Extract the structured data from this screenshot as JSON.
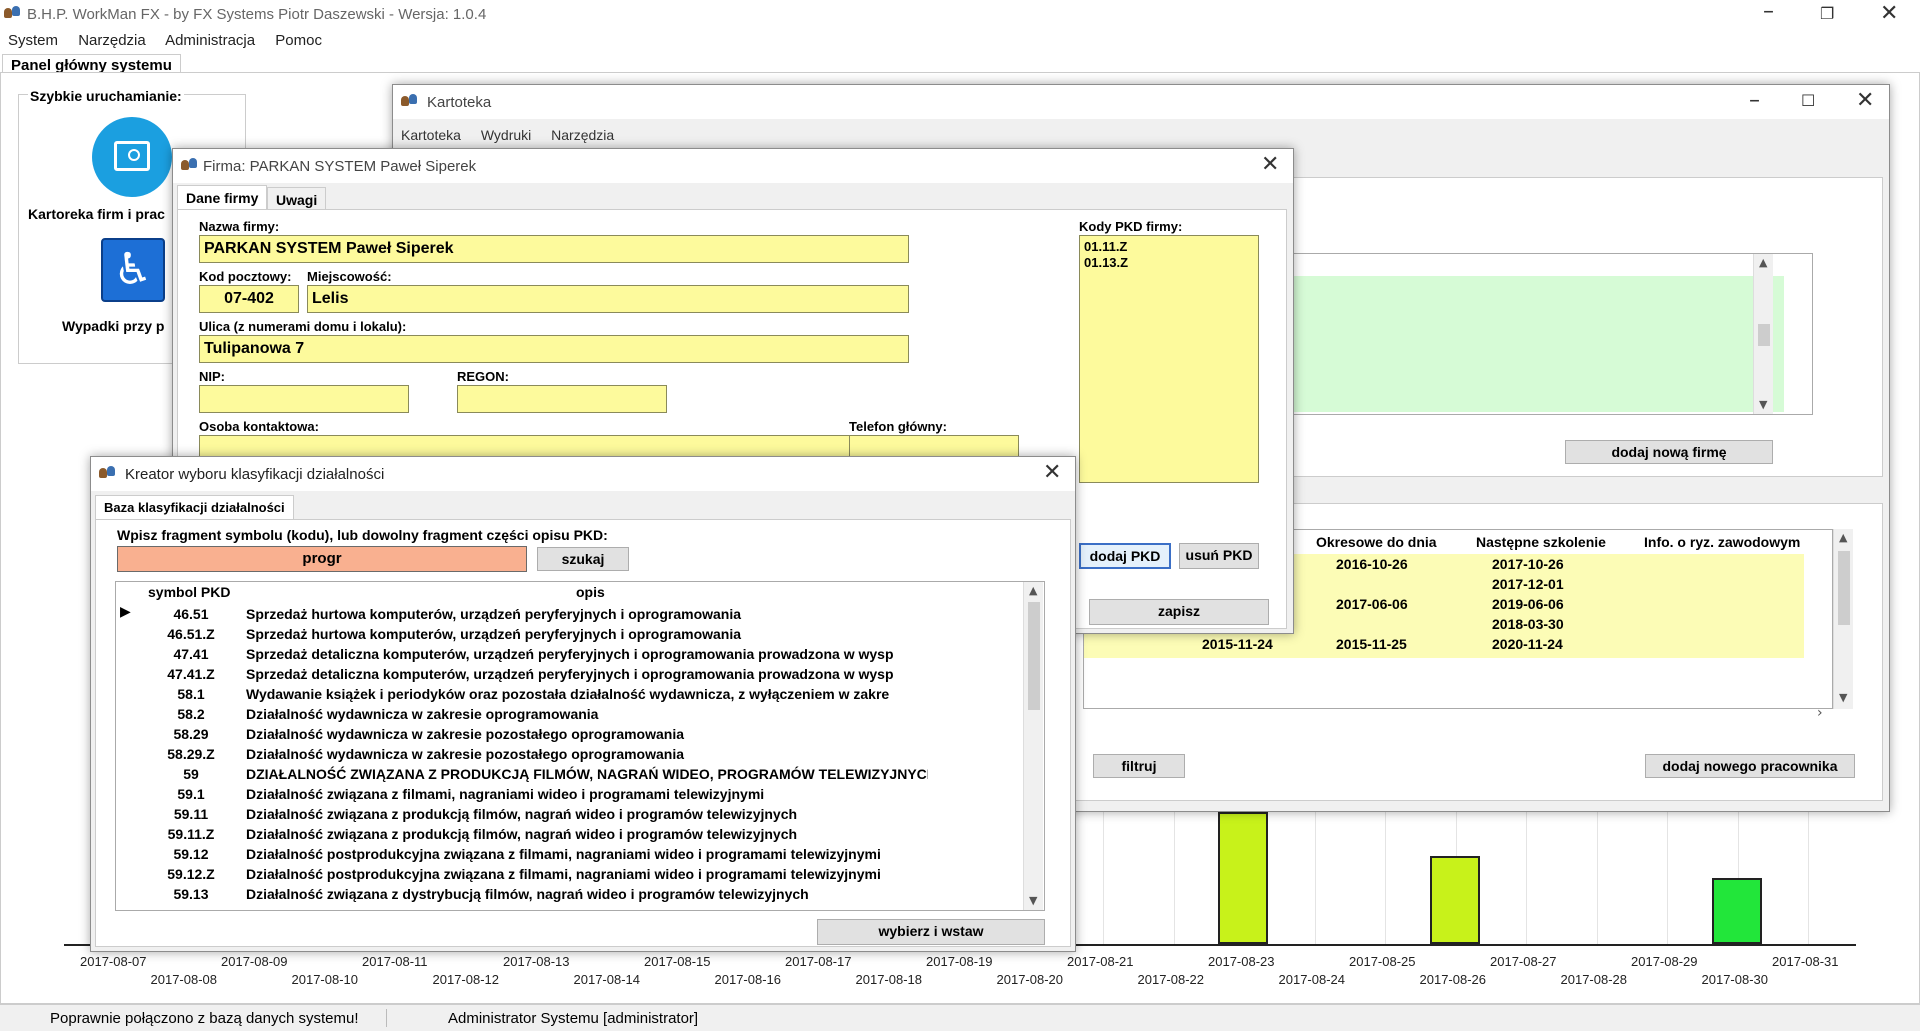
{
  "app": {
    "title": "B.H.P. WorkMan FX - by FX Systems Piotr Daszewski - Wersja: 1.0.4",
    "menu": [
      "System",
      "Narzędzia",
      "Administracja",
      "Pomoc"
    ],
    "main_tab": "Panel główny systemu"
  },
  "quick": {
    "title": "Szybkie uruchamianie:",
    "item1": "Kartoreka firm i prac",
    "item2": "Wypadki przy p"
  },
  "kartoteka": {
    "title": "Kartoteka",
    "menu": [
      "Kartoteka",
      "Wydruki",
      "Narzędzia"
    ],
    "add_company": "dodaj nową firmę",
    "headers": [
      "Okresowe do dnia",
      "Następne szkolenie",
      "Info. o ryz. zawodowym"
    ],
    "rows": [
      {
        "a": "",
        "b": "2016-10-26",
        "c": "2017-10-26"
      },
      {
        "a": "",
        "b": "",
        "c": "2017-12-01"
      },
      {
        "a": "",
        "b": "2017-06-06",
        "c": "2019-06-06"
      },
      {
        "a": "",
        "b": "",
        "c": "2018-03-30"
      },
      {
        "a": "2015-11-24",
        "b": "2015-11-25",
        "c": "2020-11-24"
      }
    ],
    "filter": "filtruj",
    "add_employee": "dodaj nowego pracownika"
  },
  "firma": {
    "title": "Firma: PARKAN SYSTEM Paweł Siperek",
    "tabs": [
      "Dane firmy",
      "Uwagi"
    ],
    "name_label": "Nazwa firmy:",
    "name": "PARKAN SYSTEM Paweł Siperek",
    "zip_label": "Kod pocztowy:",
    "zip": "07-402",
    "city_label": "Miejscowość:",
    "city": "Lelis",
    "street_label": "Ulica (z numerami domu i lokalu):",
    "street": "Tulipanowa 7",
    "nip_label": "NIP:",
    "regon_label": "REGON:",
    "contact_label": "Osoba kontaktowa:",
    "phone_label": "Telefon główny:",
    "pkd_label": "Kody PKD firmy:",
    "pkd_codes": [
      "01.11.Z",
      "01.13.Z"
    ],
    "add_pkd": "dodaj PKD",
    "remove_pkd": "usuń PKD",
    "save": "zapisz"
  },
  "kreator": {
    "title": "Kreator wyboru klasyfikacji działalności",
    "tab": "Baza klasyfikacji działalności",
    "prompt": "Wpisz fragment symbolu (kodu), lub dowolny fragment części opisu PKD:",
    "search_value": "progr",
    "search_button": "szukaj",
    "col_symbol": "symbol PKD",
    "col_desc": "opis",
    "rows": [
      {
        "s": "46.51",
        "d": "Sprzedaż hurtowa komputerów, urządzeń peryferyjnych i oprogramowania"
      },
      {
        "s": "46.51.Z",
        "d": "Sprzedaż hurtowa komputerów, urządzeń peryferyjnych i oprogramowania"
      },
      {
        "s": "47.41",
        "d": "Sprzedaż detaliczna komputerów, urządzeń peryferyjnych i oprogramowania prowadzona w wysp"
      },
      {
        "s": "47.41.Z",
        "d": "Sprzedaż detaliczna komputerów, urządzeń peryferyjnych i oprogramowania prowadzona w wysp"
      },
      {
        "s": "58.1",
        "d": "Wydawanie książek i periodyków oraz pozostała działalność wydawnicza, z wyłączeniem w zakre"
      },
      {
        "s": "58.2",
        "d": "Działalność wydawnicza w zakresie oprogramowania"
      },
      {
        "s": "58.29",
        "d": "Działalność wydawnicza w zakresie pozostałego oprogramowania"
      },
      {
        "s": "58.29.Z",
        "d": "Działalność wydawnicza w zakresie pozostałego oprogramowania"
      },
      {
        "s": "59",
        "d": "DZIAŁALNOŚĆ ZWIĄZANA Z PRODUKCJĄ FILMÓW, NAGRAŃ WIDEO, PROGRAMÓW TELEWIZYJNYCH, N"
      },
      {
        "s": "59.1",
        "d": "Działalność związana z filmami, nagraniami wideo i programami telewizyjnymi"
      },
      {
        "s": "59.11",
        "d": "Działalność związana z produkcją filmów, nagrań wideo i programów telewizyjnych"
      },
      {
        "s": "59.11.Z",
        "d": "Działalność związana z produkcją filmów, nagrań wideo i programów telewizyjnych"
      },
      {
        "s": "59.12",
        "d": "Działalność postprodukcyjna związana z filmami, nagraniami wideo i programami telewizyjnymi"
      },
      {
        "s": "59.12.Z",
        "d": "Działalność postprodukcyjna związana z filmami, nagraniami wideo i programami telewizyjnymi"
      },
      {
        "s": "59.13",
        "d": "Działalność związana z dystrybucją filmów, nagrań wideo i programów telewizyjnych"
      }
    ],
    "select_button": "wybierz i wstaw"
  },
  "chart_data": {
    "type": "bar",
    "x_labels_top": [
      "2017-08-07",
      "2017-08-09",
      "2017-08-11",
      "2017-08-13",
      "2017-08-15",
      "2017-08-17",
      "2017-08-19",
      "2017-08-21",
      "2017-08-23",
      "2017-08-25",
      "2017-08-27",
      "2017-08-29",
      "2017-08-31"
    ],
    "x_labels_bottom": [
      "2017-08-08",
      "2017-08-10",
      "2017-08-12",
      "2017-08-14",
      "2017-08-16",
      "2017-08-18",
      "2017-08-20",
      "2017-08-22",
      "2017-08-24",
      "2017-08-26",
      "2017-08-28",
      "2017-08-30"
    ],
    "bars": [
      {
        "date": "2017-08-23",
        "value": 3,
        "color": "#c8f21a"
      },
      {
        "date": "2017-08-26",
        "value": 2,
        "color": "#c8f21a"
      },
      {
        "date": "2017-08-30",
        "value": 1.5,
        "color": "#22e63a"
      }
    ]
  },
  "status": {
    "connection": "Poprawnie połączono z bazą danych systemu!",
    "user": "Administrator Systemu [administrator]"
  }
}
